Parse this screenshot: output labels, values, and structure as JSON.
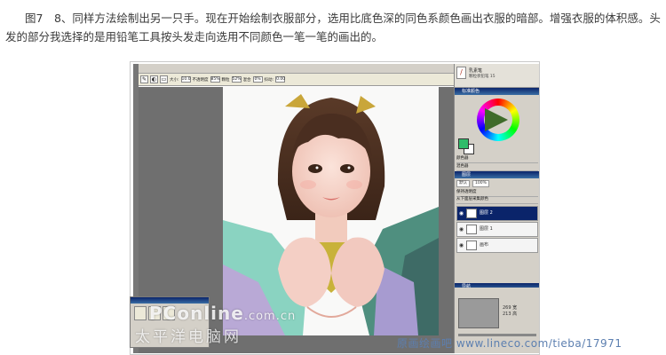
{
  "caption": {
    "text": "图7　8、同样方法绘制出另一只手。现在开始绘制衣服部分，选用比底色深的同色系颜色画出衣服的暗部。增强衣服的体积感。头发的部分我选择的是用铅笔工具按头发走向选用不同颜色一笔一笔的画出的。"
  },
  "app": {
    "options": {
      "size_label": "大小:",
      "size_value": "10.0",
      "opacity_label": "不透明度",
      "opacity_value": "85%",
      "blur_label": "颗粒",
      "blur_value": "52%",
      "blend_label": "混合",
      "blend_value": "0%",
      "jitter_label": "抖动:",
      "jitter_value": "0.00"
    },
    "brush": {
      "name": "乳素笔",
      "sub": "颗粒状铅笔 15"
    },
    "panels": {
      "color_title": "标准颜色",
      "color_set": "颜色器",
      "color_mix": "混色器",
      "layers_title": "图层",
      "layer_opacity": "100%",
      "blend_mode": "默认",
      "preserve": "保持透明度",
      "pick_below": "从下面层采集颜色",
      "navigator_title": "导航"
    },
    "layers": [
      {
        "name": "图层 2",
        "selected": true
      },
      {
        "name": "图层 1",
        "selected": false
      },
      {
        "name": "画布",
        "selected": false
      }
    ],
    "navigator": {
      "w": "269 宽",
      "h": "213 高"
    }
  },
  "watermarks": {
    "pconline": "PConline",
    "pconline_domain": ".com.cn",
    "cn_name": "太平洋电脑网",
    "tieba": "原画绘画吧 www.lineco.com/tieba/17971"
  }
}
